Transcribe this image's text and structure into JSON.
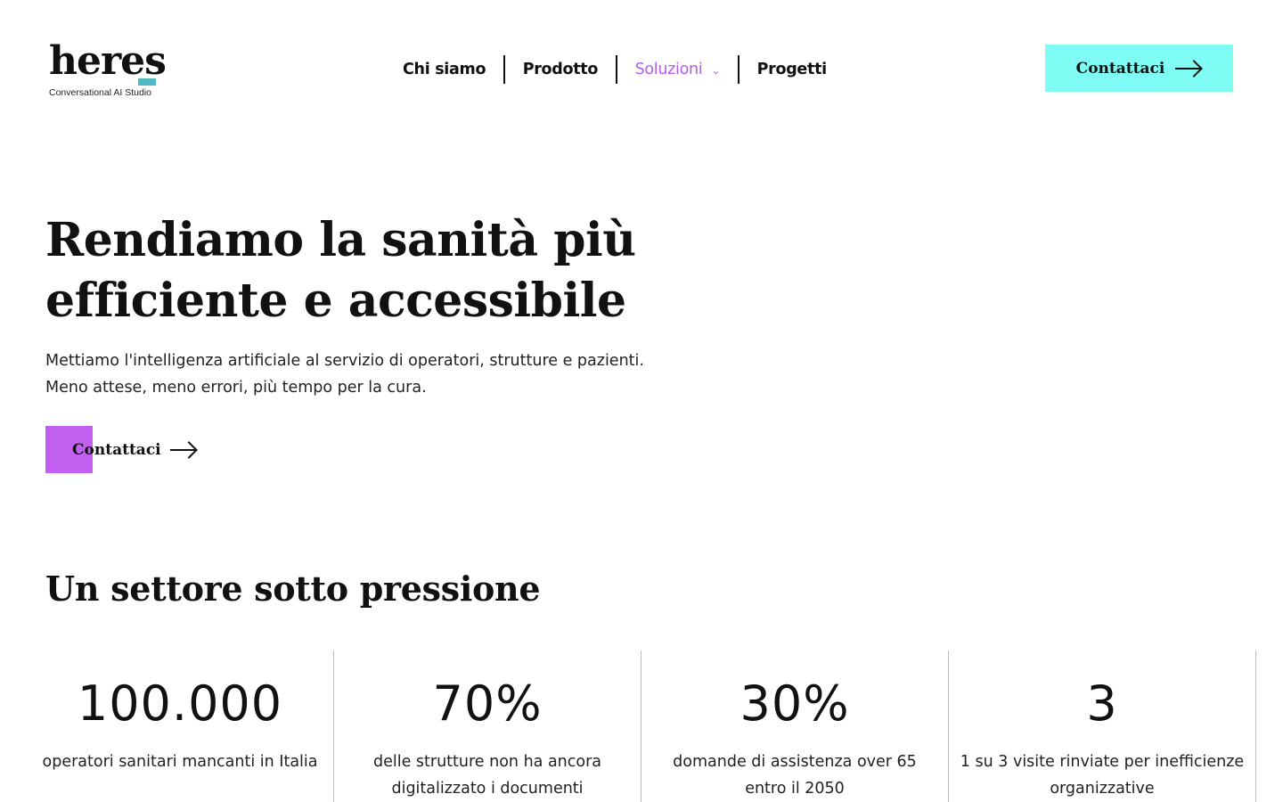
{
  "logo": {
    "word": "heres",
    "tagline": "Conversational AI Studio"
  },
  "nav": {
    "items": [
      {
        "label": "Chi siamo"
      },
      {
        "label": "Prodotto"
      },
      {
        "label": "Soluzioni"
      },
      {
        "label": "Progetti"
      }
    ]
  },
  "header_cta": {
    "label": "Contattaci"
  },
  "hero": {
    "title_line1": "Rendiamo la sanità più",
    "title_line2": "efficiente e accessibile",
    "sub_line1": "Mettiamo l'intelligenza artificiale al servizio di operatori, strutture e pazienti.",
    "sub_line2": "Meno attese, meno errori, più tempo per la cura.",
    "cta_label": "Contattaci"
  },
  "section": {
    "title": "Un settore sotto pressione",
    "stats": [
      {
        "value": "100.000",
        "label": "operatori sanitari mancanti in Italia"
      },
      {
        "value": "70%",
        "label": "delle strutture non ha ancora digitalizzato i documenti"
      },
      {
        "value": "30%",
        "label": "domande di assistenza over 65 entro il 2050"
      },
      {
        "value": "3",
        "label": "1 su 3 visite rinviate per inefficienze organizzative"
      }
    ]
  },
  "colors": {
    "accent_cyan": "#7ffcf3",
    "accent_purple": "#c260f2",
    "nav_active": "#b65ce8",
    "logo_accent": "#4fb8c4"
  },
  "icons": {
    "nav_dropdown": "chevron-down-icon",
    "cta_arrow": "arrow-right-icon"
  }
}
